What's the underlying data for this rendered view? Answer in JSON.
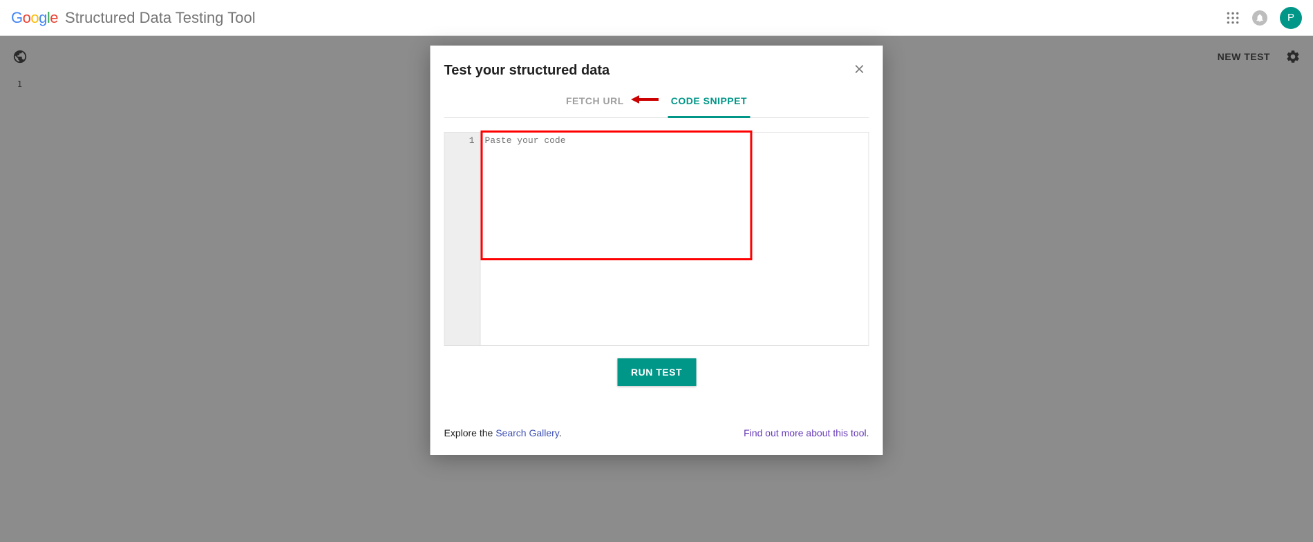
{
  "header": {
    "app_title": "Structured Data Testing Tool",
    "avatar_initial": "P"
  },
  "toolbar": {
    "new_test_label": "NEW TEST"
  },
  "bg_editor": {
    "line_number": "1"
  },
  "modal": {
    "title": "Test your structured data",
    "tabs": {
      "fetch_url": "FETCH URL",
      "code_snippet": "CODE SNIPPET"
    },
    "code_editor": {
      "line_number": "1",
      "placeholder": "Paste your code"
    },
    "run_button": "RUN TEST",
    "footer": {
      "explore_prefix": "Explore the ",
      "explore_link": "Search Gallery",
      "explore_suffix": ".",
      "find_out_link": "Find out more about this tool.",
      "find_out_suffix": ""
    }
  }
}
